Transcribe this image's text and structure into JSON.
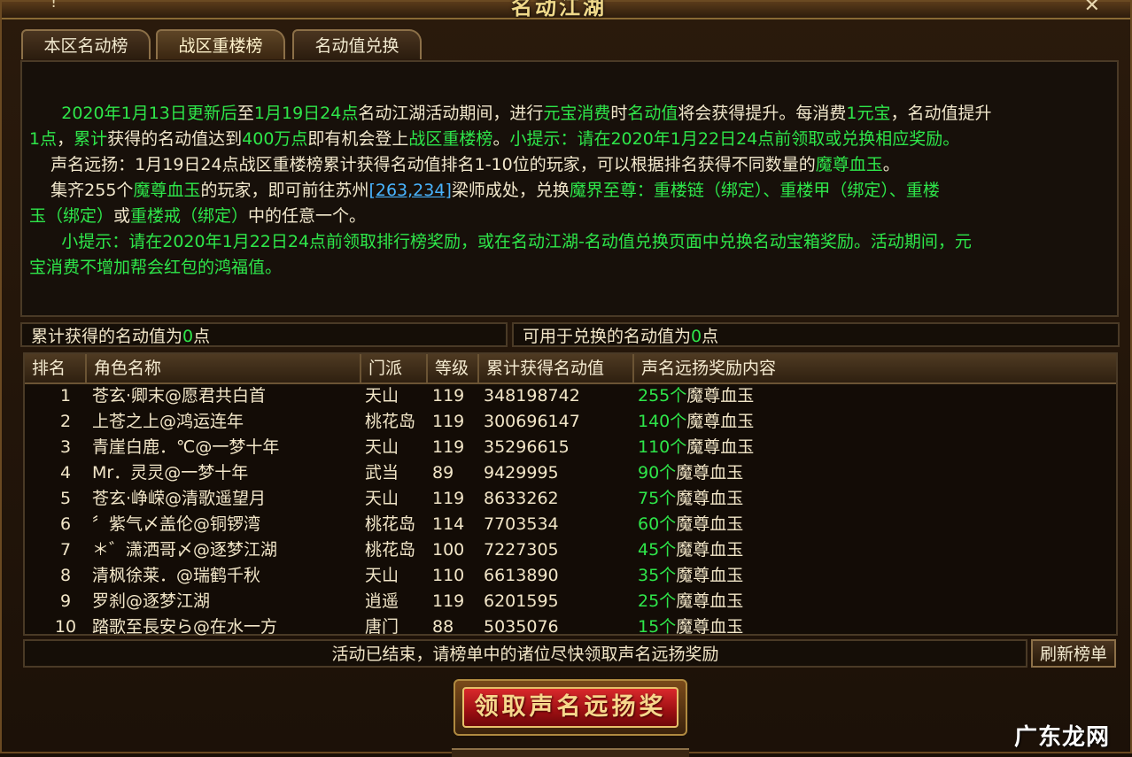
{
  "window": {
    "title": "名动江湖",
    "close_glyph": "✕",
    "menu_glyph": "!"
  },
  "tabs": [
    {
      "label": "本区名动榜",
      "active": false
    },
    {
      "label": "战区重楼榜",
      "active": true
    },
    {
      "label": "名动值兑换",
      "active": false
    }
  ],
  "info": {
    "p1_line1": [
      "2020年1月13日更新后",
      "至",
      "1月19日24点",
      "名动江湖活动期间，进行",
      "元宝消费",
      "时",
      "名动值",
      "将会获得提升。每消费",
      "1元宝",
      "，名动值提升"
    ],
    "p1_line2": [
      "1点",
      "，",
      "累计",
      "获得的名动值达到",
      "400万点",
      "即有机会登上",
      "战区重楼榜",
      "。",
      "小提示：请在2020年1月22日24点前领取或兑换相应奖励。"
    ],
    "p2": [
      "声名远扬：1月19日24点战区重楼榜累计获得名动值排名1-10位的玩家，可以根据排名获得不同数量的",
      "魔尊血玉",
      "。"
    ],
    "p3_line1": [
      "集齐255个",
      "魔尊血玉",
      "的玩家，即可前往苏州",
      "[263,234]",
      "梁师成处，兑换",
      "魔界至尊：重楼链（绑定）、重楼甲（绑定）、重楼"
    ],
    "p3_line2": [
      "玉（绑定）",
      "或",
      "重楼戒（绑定）",
      "中的任意一个。"
    ],
    "p4_line1": "小提示：请在2020年1月22日24点前领取排行榜奖励，或在名动江湖-名动值兑换页面中兑换名动宝箱奖励。活动期间，元",
    "p4_line2": "宝消费不增加帮会红包的鸿福值。"
  },
  "summary": {
    "total_label": "累计获得的名动值为",
    "total_value": "0",
    "total_unit": "点",
    "exchange_label": "可用于兑换的名动值为",
    "exchange_value": "0",
    "exchange_unit": "点"
  },
  "table": {
    "headers": [
      "排名",
      "角色名称",
      "门派",
      "等级",
      "累计获得名动值",
      "声名远扬奖励内容"
    ],
    "rows": [
      {
        "rank": "1",
        "name": "苍玄·卿末@愿君共白首",
        "sect": "天山",
        "level": "119",
        "value": "348198742",
        "reward_count": "255个",
        "reward_item": "魔尊血玉"
      },
      {
        "rank": "2",
        "name": "上苍之上@鸿运连年",
        "sect": "桃花岛",
        "level": "119",
        "value": "300696147",
        "reward_count": "140个",
        "reward_item": "魔尊血玉"
      },
      {
        "rank": "3",
        "name": "青崖白鹿．℃@一梦十年",
        "sect": "天山",
        "level": "119",
        "value": "35296615",
        "reward_count": "110个",
        "reward_item": "魔尊血玉"
      },
      {
        "rank": "4",
        "name": "Mr．灵灵@一梦十年",
        "sect": "武当",
        "level": "89",
        "value": "9429995",
        "reward_count": "90个",
        "reward_item": "魔尊血玉"
      },
      {
        "rank": "5",
        "name": "苍玄·峥嵘@清歌遥望月",
        "sect": "天山",
        "level": "119",
        "value": "8633262",
        "reward_count": "75个",
        "reward_item": "魔尊血玉"
      },
      {
        "rank": "6",
        "name": "〞紫气〆盖伦@铜锣湾",
        "sect": "桃花岛",
        "level": "114",
        "value": "7703534",
        "reward_count": "60个",
        "reward_item": "魔尊血玉"
      },
      {
        "rank": "7",
        "name": "＊゛潇洒哥〆@逐梦江湖",
        "sect": "桃花岛",
        "level": "100",
        "value": "7227305",
        "reward_count": "45个",
        "reward_item": "魔尊血玉"
      },
      {
        "rank": "8",
        "name": "清枫徐莱．@瑞鹤千秋",
        "sect": "天山",
        "level": "110",
        "value": "6613890",
        "reward_count": "35个",
        "reward_item": "魔尊血玉"
      },
      {
        "rank": "9",
        "name": "罗刹@逐梦江湖",
        "sect": "逍遥",
        "level": "119",
        "value": "6201595",
        "reward_count": "25个",
        "reward_item": "魔尊血玉"
      },
      {
        "rank": "10",
        "name": "踏歌至長安ら@在水一方",
        "sect": "唐门",
        "level": "88",
        "value": "5035076",
        "reward_count": "15个",
        "reward_item": "魔尊血玉"
      }
    ]
  },
  "footer": {
    "notice": "活动已结束，请榜单中的诸位尽快领取声名远扬奖励",
    "refresh_label": "刷新榜单",
    "claim_label": "领取声名远扬奖"
  },
  "watermark": "广东龙网",
  "colors": {
    "highlight_green": "#2ee64a",
    "link_blue": "#49b4ff",
    "button_red": "#c3181b"
  }
}
